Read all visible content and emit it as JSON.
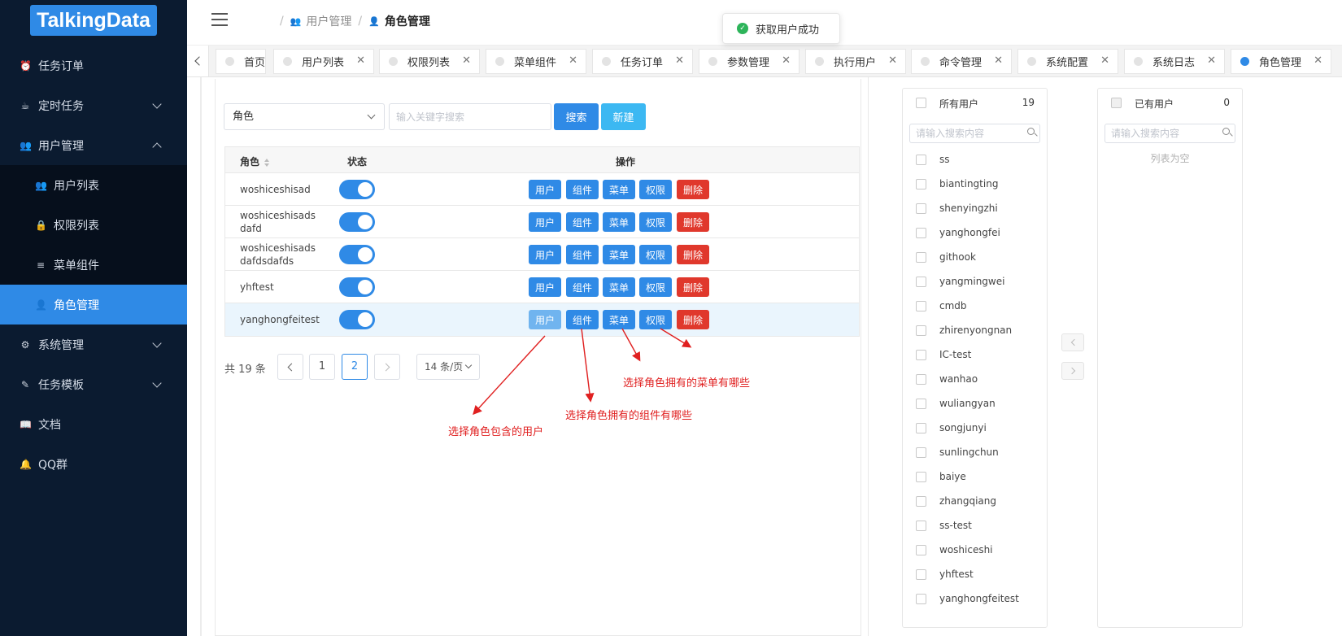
{
  "app": {
    "logo_text": "TalkingData",
    "brand_color": "#2f8ae6",
    "sidebar_bg": "#0b1b30"
  },
  "sidebar": {
    "items": [
      {
        "label": "任务订单",
        "icon": "alarm-clock-icon"
      },
      {
        "label": "定时任务",
        "icon": "cup-icon",
        "expandable": true
      },
      {
        "label": "用户管理",
        "icon": "users-icon",
        "expanded": true
      },
      {
        "label": "用户列表",
        "icon": "user-group-icon"
      },
      {
        "label": "权限列表",
        "icon": "lock-icon"
      },
      {
        "label": "菜单组件",
        "icon": "list-icon"
      },
      {
        "label": "角色管理",
        "icon": "user-icon",
        "active": true
      },
      {
        "label": "系统管理",
        "icon": "gear-icon",
        "expandable": true
      },
      {
        "label": "任务模板",
        "icon": "template-icon",
        "expandable": true
      },
      {
        "label": "文档",
        "icon": "book-icon"
      },
      {
        "label": "QQ群",
        "icon": "qq-icon"
      }
    ]
  },
  "header": {
    "breadcrumb": {
      "sep": "/",
      "parent": "用户管理",
      "current": "角色管理"
    },
    "toast": "获取用户成功"
  },
  "tabs": [
    {
      "label": "首页",
      "closable": false
    },
    {
      "label": "用户列表",
      "closable": true
    },
    {
      "label": "权限列表",
      "closable": true
    },
    {
      "label": "菜单组件",
      "closable": true
    },
    {
      "label": "任务订单",
      "closable": true
    },
    {
      "label": "参数管理",
      "closable": true
    },
    {
      "label": "执行用户",
      "closable": true
    },
    {
      "label": "命令管理",
      "closable": true
    },
    {
      "label": "系统配置",
      "closable": true
    },
    {
      "label": "系统日志",
      "closable": true
    },
    {
      "label": "角色管理",
      "closable": true,
      "active": true
    }
  ],
  "filter": {
    "select_value": "角色",
    "keyword_placeholder": "输入关键字搜索",
    "search_label": "搜索",
    "new_label": "新建"
  },
  "table": {
    "columns": {
      "role": "角色",
      "status": "状态",
      "ops": "操作"
    },
    "op_labels": {
      "user": "用户",
      "component": "组件",
      "menu": "菜单",
      "perm": "权限",
      "delete": "删除"
    },
    "rows": [
      {
        "name": "woshiceshisad",
        "enabled": true
      },
      {
        "name": "woshiceshisads dafd",
        "enabled": true
      },
      {
        "name": "woshiceshisads dafdsdafds",
        "enabled": true
      },
      {
        "name": "yhftest",
        "enabled": true
      },
      {
        "name": "yanghongfeitest",
        "enabled": true,
        "highlighted": true
      }
    ]
  },
  "pagination": {
    "total_text": "共 19 条",
    "pages": [
      "1",
      "2"
    ],
    "current": "2",
    "size_text": "14 条/页"
  },
  "annotations": {
    "user": "选择角色包含的用户",
    "component": "选择角色拥有的组件有哪些",
    "menu": "选择角色拥有的菜单有哪些",
    "color": "#e02020"
  },
  "transfer": {
    "left": {
      "title": "所有用户",
      "count": "19",
      "placeholder": "请输入搜索内容",
      "items": [
        "ss",
        "biantingting",
        "shenyingzhi",
        "yanghongfei",
        "githook",
        "yangmingwei",
        "cmdb",
        "zhirenyongnan",
        "IC-test",
        "wanhao",
        "wuliangyan",
        "songjunyi",
        "sunlingchun",
        "baiye",
        "zhangqiang",
        "ss-test",
        "woshiceshi",
        "yhftest",
        "yanghongfeitest"
      ]
    },
    "right": {
      "title": "已有用户",
      "count": "0",
      "placeholder": "请输入搜索内容",
      "empty_text": "列表为空"
    }
  }
}
